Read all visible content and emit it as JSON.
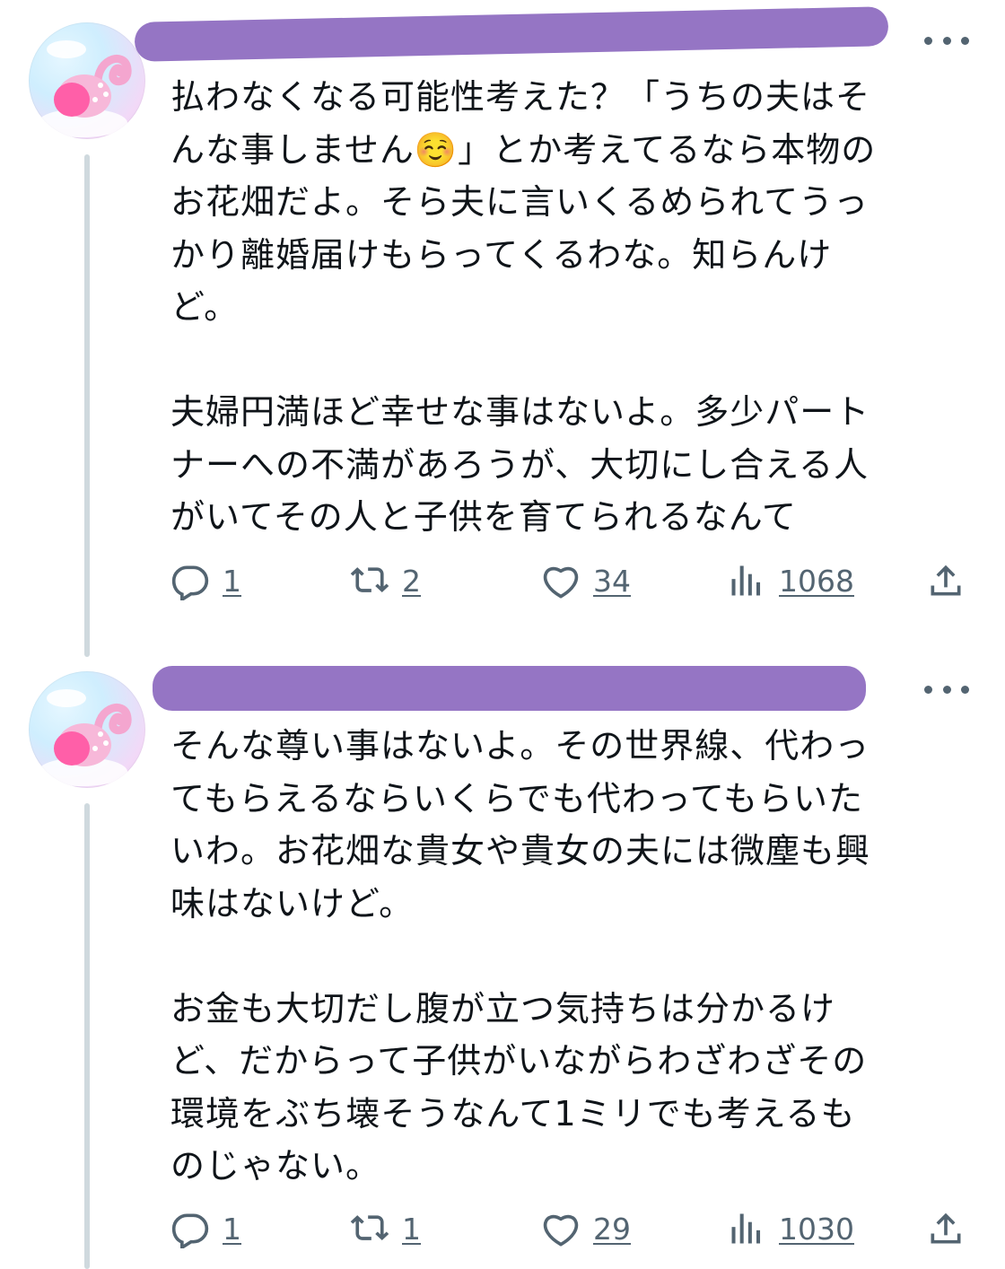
{
  "tweets": [
    {
      "text": "払わなくなる可能性考えた？「うちの夫はそ\nんな事しません☺️」とか考えてるなら本物の\nお花畑だよ。そら夫に言いくるめられてうっ\nかり離婚届けもらってくるわな。知らんけ\nど。\n\n夫婦円満ほど幸せな事はないよ。多少パート\nナーへの不満があろうが、大切にし合える人\nがいてその人と子供を育てられるなんて",
      "replies": "1",
      "reposts": "2",
      "likes": "34",
      "views": "1068"
    },
    {
      "text": "そんな尊い事はないよ。その世界線、代わっ\nてもらえるならいくらでも代わってもらいた\nいわ。お花畑な貴女や貴女の夫には微塵も興\n味はないけど。\n\nお金も大切だし腹が立つ気持ちは分かるけ\nど、だからって子供がいながらわざわざその\n環境をぶち壊そうなんて1ミリでも考えるも\nのじゃない。",
      "replies": "1",
      "reposts": "1",
      "likes": "29",
      "views": "1030"
    }
  ],
  "icons": {
    "more": "more-icon",
    "reply": "reply-icon",
    "repost": "repost-icon",
    "like": "heart-icon",
    "views": "views-icon",
    "share": "share-icon"
  },
  "colors": {
    "text": "#0f1419",
    "secondary": "#536471",
    "thread_line": "#cfd9de",
    "redaction": "#9575c4"
  }
}
